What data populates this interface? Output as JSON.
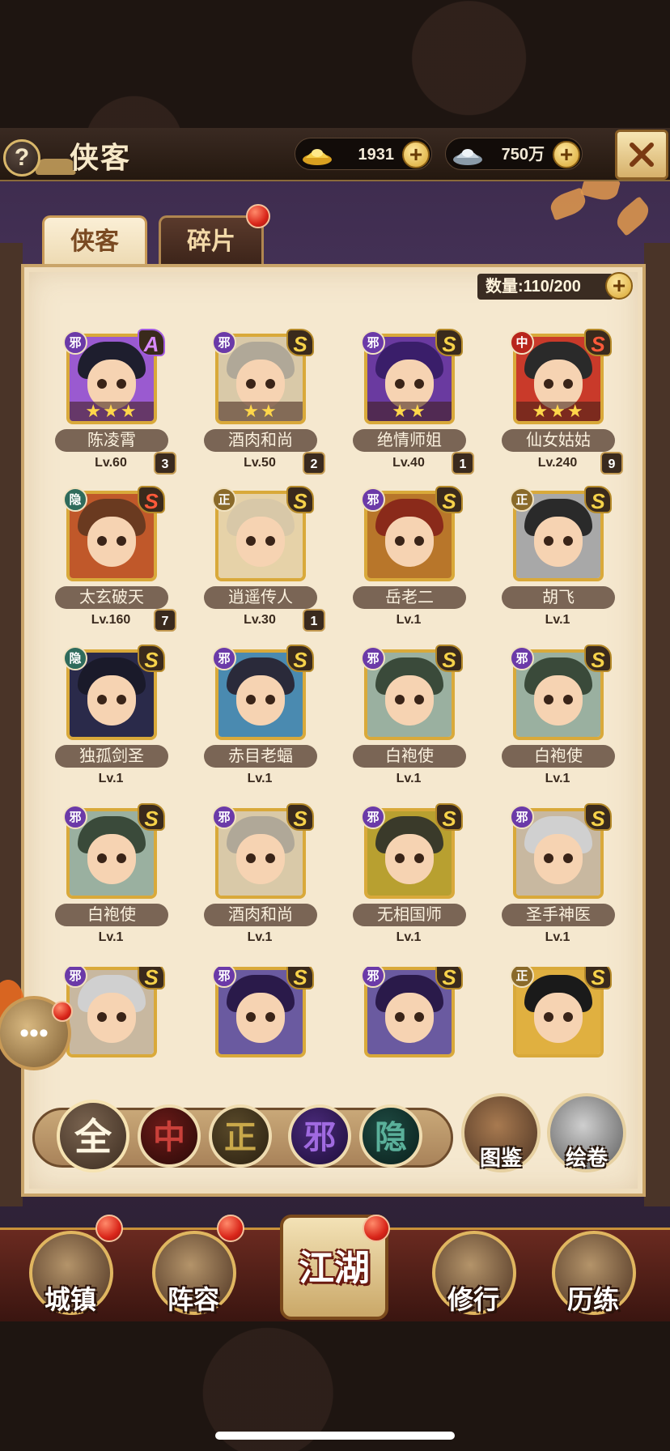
{
  "header": {
    "help_icon": "?",
    "title": "侠客",
    "gold": "1931",
    "silver": "750万",
    "plus": "+"
  },
  "tabs": [
    {
      "label": "侠客",
      "active": true
    },
    {
      "label": "碎片",
      "active": false,
      "notification": true
    }
  ],
  "inventory": {
    "count_label": "数量:110/200"
  },
  "heroes": [
    {
      "name": "陈凌霄",
      "level": "Lv.60",
      "shards": "3",
      "faction": "邪",
      "rank": "A",
      "stars": "★★★",
      "portrait_bg": "#9a5ad0",
      "hair": "#1e1e2e"
    },
    {
      "name": "酒肉和尚",
      "level": "Lv.50",
      "shards": "2",
      "faction": "邪",
      "rank": "S",
      "stars": "★★",
      "portrait_bg": "#d9c9a8",
      "hair": "#b0a898"
    },
    {
      "name": "绝情师姐",
      "level": "Lv.40",
      "shards": "1",
      "faction": "邪",
      "rank": "S",
      "stars": "★★",
      "portrait_bg": "#6a3aa0",
      "hair": "#3a1e6a"
    },
    {
      "name": "仙女姑姑",
      "level": "Lv.240",
      "shards": "9",
      "faction": "中",
      "rank": "S",
      "stars": "★★★",
      "portrait_bg": "#c93a2a",
      "hair": "#2a2a2a"
    },
    {
      "name": "太玄破天",
      "level": "Lv.160",
      "shards": "7",
      "faction": "隐",
      "rank": "S",
      "stars": "",
      "portrait_bg": "#c0582a",
      "hair": "#6a3a20"
    },
    {
      "name": "逍遥传人",
      "level": "Lv.30",
      "shards": "1",
      "faction": "正",
      "rank": "S",
      "stars": "",
      "portrait_bg": "#e6d2a8",
      "hair": "#d8c8a8"
    },
    {
      "name": "岳老二",
      "level": "Lv.1",
      "shards": "",
      "faction": "邪",
      "rank": "S",
      "stars": "",
      "portrait_bg": "#b8762a",
      "hair": "#8a2a1a"
    },
    {
      "name": "胡飞",
      "level": "Lv.1",
      "shards": "",
      "faction": "正",
      "rank": "S",
      "stars": "",
      "portrait_bg": "#a8a8a8",
      "hair": "#2a2a2a"
    },
    {
      "name": "独孤剑圣",
      "level": "Lv.1",
      "shards": "",
      "faction": "隐",
      "rank": "S",
      "stars": "",
      "portrait_bg": "#2a2a4a",
      "hair": "#1a1a2a"
    },
    {
      "name": "赤目老蝠",
      "level": "Lv.1",
      "shards": "",
      "faction": "邪",
      "rank": "S",
      "stars": "",
      "portrait_bg": "#4a8ab0",
      "hair": "#2a2a3a"
    },
    {
      "name": "白袍使",
      "level": "Lv.1",
      "shards": "",
      "faction": "邪",
      "rank": "S",
      "stars": "",
      "portrait_bg": "#9ab0a0",
      "hair": "#3a4a3a"
    },
    {
      "name": "白袍使",
      "level": "Lv.1",
      "shards": "",
      "faction": "邪",
      "rank": "S",
      "stars": "",
      "portrait_bg": "#9ab0a0",
      "hair": "#3a4a3a"
    },
    {
      "name": "白袍使",
      "level": "Lv.1",
      "shards": "",
      "faction": "邪",
      "rank": "S",
      "stars": "",
      "portrait_bg": "#9ab0a0",
      "hair": "#3a4a3a"
    },
    {
      "name": "酒肉和尚",
      "level": "Lv.1",
      "shards": "",
      "faction": "邪",
      "rank": "S",
      "stars": "",
      "portrait_bg": "#d9c9a8",
      "hair": "#b0a898"
    },
    {
      "name": "无相国师",
      "level": "Lv.1",
      "shards": "",
      "faction": "邪",
      "rank": "S",
      "stars": "",
      "portrait_bg": "#b8a030",
      "hair": "#3a3a2a"
    },
    {
      "name": "圣手神医",
      "level": "Lv.1",
      "shards": "",
      "faction": "邪",
      "rank": "S",
      "stars": "",
      "portrait_bg": "#c8b8a0",
      "hair": "#d0d0d0"
    },
    {
      "name": "",
      "level": "",
      "shards": "",
      "faction": "邪",
      "rank": "S",
      "stars": "",
      "portrait_bg": "#c8b8a0",
      "hair": "#d0d0d0"
    },
    {
      "name": "",
      "level": "",
      "shards": "",
      "faction": "邪",
      "rank": "S",
      "stars": "",
      "portrait_bg": "#6a5aa0",
      "hair": "#2a1a4a"
    },
    {
      "name": "",
      "level": "",
      "shards": "",
      "faction": "邪",
      "rank": "S",
      "stars": "",
      "portrait_bg": "#6a5aa0",
      "hair": "#2a1a4a"
    },
    {
      "name": "",
      "level": "",
      "shards": "",
      "faction": "正",
      "rank": "S",
      "stars": "",
      "portrait_bg": "#e0b040",
      "hair": "#1a1a1a"
    }
  ],
  "filters": {
    "all": "全",
    "zhong": "中",
    "zheng": "正",
    "xie": "邪",
    "yin": "隐"
  },
  "side_buttons": {
    "atlas": "图鉴",
    "scroll": "绘卷"
  },
  "float": {
    "chat_icon": "•••"
  },
  "bottom_nav": [
    {
      "label": "城镇",
      "notification": true
    },
    {
      "label": "阵容",
      "notification": true
    },
    {
      "label": "江湖",
      "notification": true
    },
    {
      "label": "修行",
      "notification": false
    },
    {
      "label": "历练",
      "notification": false
    }
  ]
}
